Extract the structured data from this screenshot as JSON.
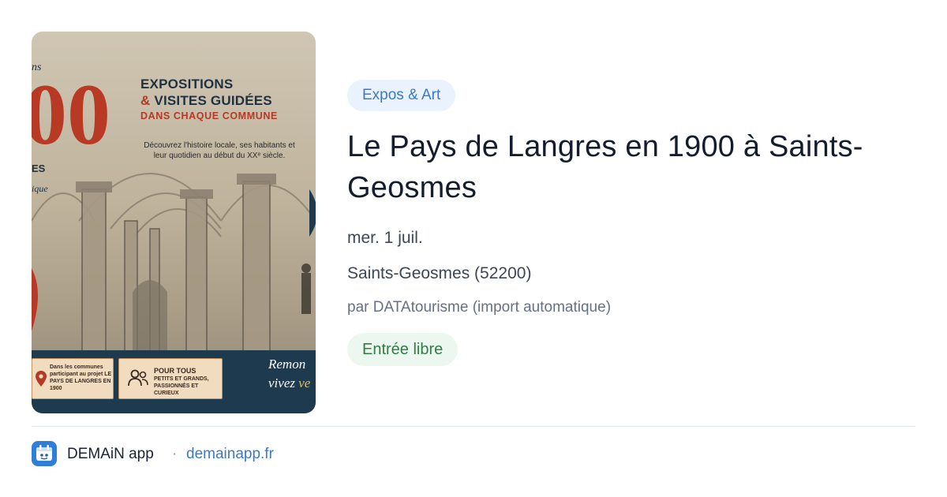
{
  "event": {
    "category": "Expos & Art",
    "title": "Le Pays de Langres en 1900 à Saints-Geosmes",
    "date": "mer. 1 juil.",
    "location": "Saints-Geosmes (52200)",
    "author": "par DATAtourisme (import automatique)",
    "price": "Entrée libre"
  },
  "poster": {
    "title_line1": "EXPOSITIONS",
    "title_amp": "&",
    "title_line2": " VISITES GUIDÉES",
    "subtitle": "DANS CHAQUE COMMUNE",
    "description": "Découvrez l'histoire locale, ses habitants et leur quotidien au début du XXᵉ siècle.",
    "big_number": "00",
    "fragment1": "ns",
    "fragment2": "ES",
    "fragment3": "ique",
    "box1_text": "Dans les communes participant au projet LE PAYS DE LANGRES EN 1900",
    "box2_head": "POUR TOUS",
    "box2_text": "PETITS ET GRANDS, PASSIONNÉS ET CURIEUX",
    "script_line1": "Remon",
    "script_line2a": "vivez ",
    "script_line2b": "ve"
  },
  "footer": {
    "app_name": "DEMAiN app",
    "separator": "·",
    "url": "demainapp.fr"
  },
  "icons": {
    "app_icon": "demain-app-icon",
    "poster_pin": "location-pin-icon",
    "poster_people": "people-icon"
  },
  "colors": {
    "category_bg": "#eaf2fd",
    "category_text": "#3a78c9",
    "price_bg": "#ecf8ef",
    "price_text": "#2f7d44",
    "link": "#3a78c9",
    "poster_red": "#b83a25",
    "poster_navy": "#1e3a4e"
  }
}
